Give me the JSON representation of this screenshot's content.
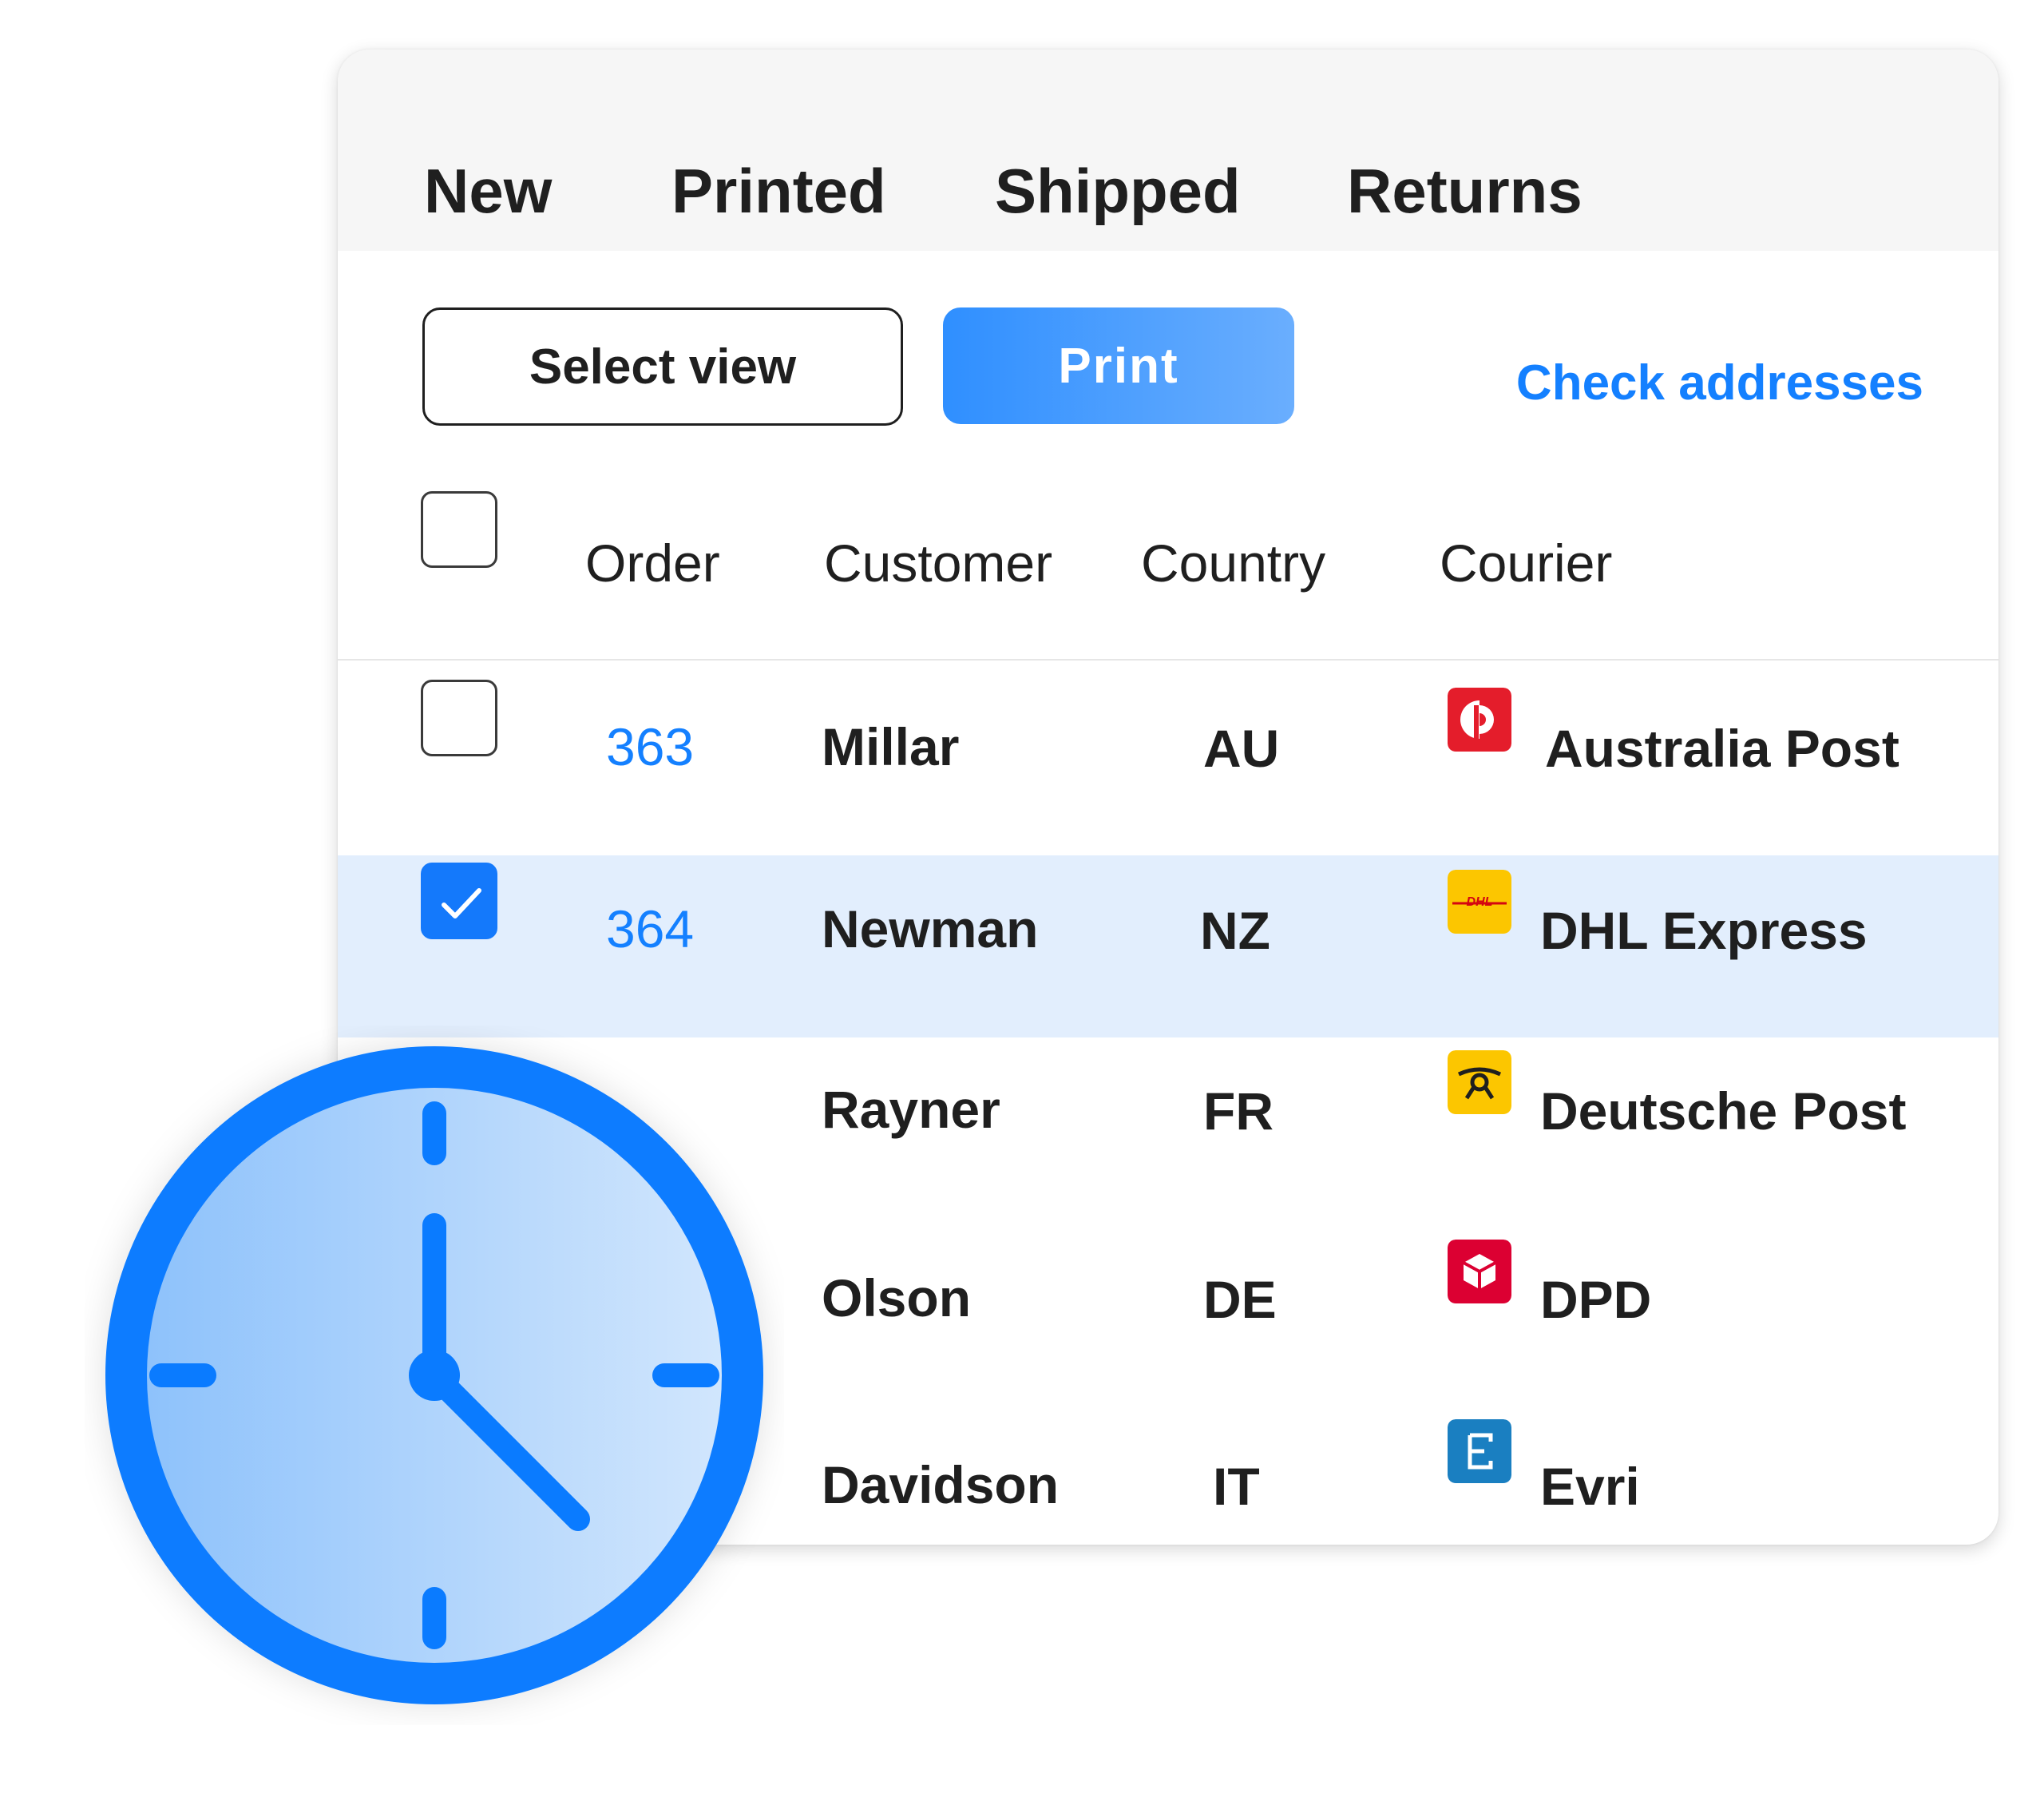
{
  "tabs": [
    {
      "label": "New"
    },
    {
      "label": "Printed"
    },
    {
      "label": "Shipped"
    },
    {
      "label": "Returns"
    }
  ],
  "toolbar": {
    "select_view_label": "Select view",
    "print_label": "Print",
    "check_addresses_label": "Check addresses"
  },
  "table": {
    "headers": {
      "order": "Order",
      "customer": "Customer",
      "country": "Country",
      "courier": "Courier"
    },
    "rows": [
      {
        "order": "363",
        "customer": "Millar",
        "country": "AU",
        "courier": "Australia Post",
        "courier_icon": "australia-post-logo-icon",
        "checked": false
      },
      {
        "order": "364",
        "customer": "Newman",
        "country": "NZ",
        "courier": "DHL Express",
        "courier_icon": "dhl-logo-icon",
        "checked": true
      },
      {
        "order": "",
        "customer": "Rayner",
        "country": "FR",
        "courier": "Deutsche Post",
        "courier_icon": "deutsche-post-logo-icon",
        "checked": false
      },
      {
        "order": "",
        "customer": "Olson",
        "country": "DE",
        "courier": "DPD",
        "courier_icon": "dpd-logo-icon",
        "checked": false
      },
      {
        "order": "",
        "customer": "Davidson",
        "country": "IT",
        "courier": "Evri",
        "courier_icon": "evri-logo-icon",
        "checked": false
      }
    ]
  },
  "colors": {
    "accent": "#1480ff",
    "selected_row": "#e2eefd",
    "clock_ring": "#0a7bff"
  },
  "icons": {
    "clock": "clock-icon",
    "check": "checkmark-icon"
  }
}
